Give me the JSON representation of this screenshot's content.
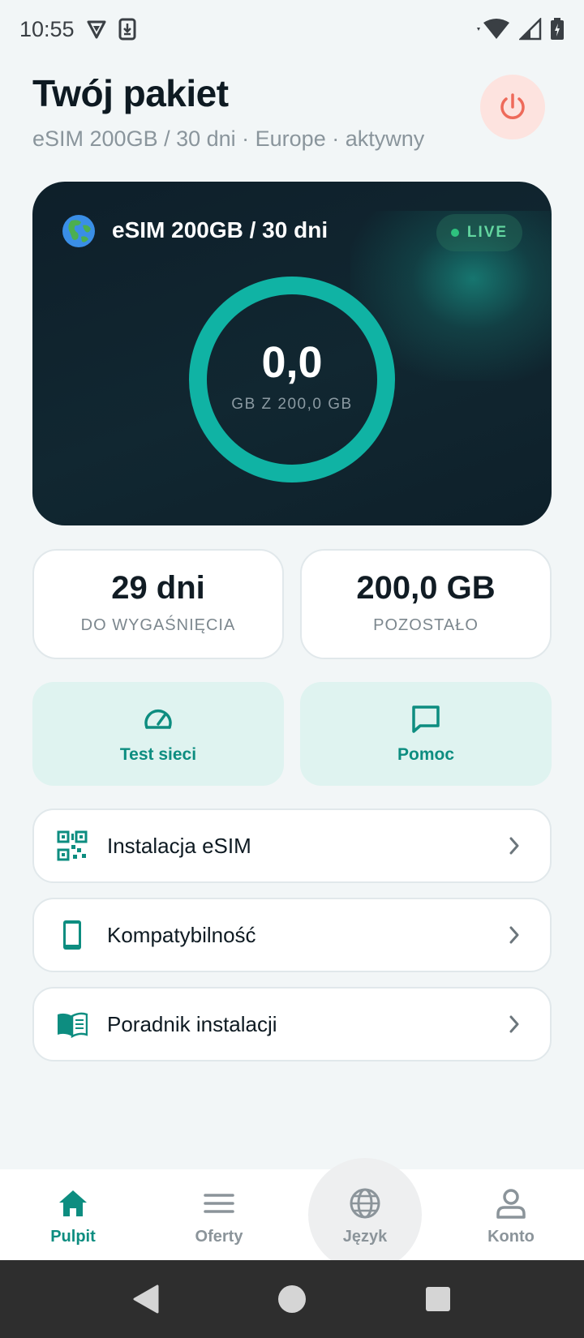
{
  "status_bar": {
    "time": "10:55",
    "icons": [
      "vpn-shield-icon",
      "download-icon",
      "wifi-icon",
      "signal-icon",
      "battery-icon"
    ]
  },
  "header": {
    "title": "Twój pakiet",
    "subtitle": "eSIM 200GB / 30 dni · Europe · aktywny",
    "power_icon": "power-icon"
  },
  "usage_card": {
    "plan_name": "eSIM 200GB / 30 dni",
    "badge": "LIVE",
    "used_value": "0,0",
    "caption": "GB Z 200,0 GB",
    "used_fraction": 0.0,
    "flag_icon": "globe-europe-emoji"
  },
  "stats": [
    {
      "value": "29 dni",
      "label": "DO WYGAŚNIĘCIA"
    },
    {
      "value": "200,0 GB",
      "label": "POZOSTAŁO"
    }
  ],
  "actions": [
    {
      "label": "Test sieci",
      "icon": "speedometer-icon"
    },
    {
      "label": "Pomoc",
      "icon": "chat-bubble-icon"
    }
  ],
  "menu": [
    {
      "label": "Instalacja eSIM",
      "icon": "qr-code-icon"
    },
    {
      "label": "Kompatybilność",
      "icon": "smartphone-icon"
    },
    {
      "label": "Poradnik instalacji",
      "icon": "book-icon"
    }
  ],
  "bottom_nav": [
    {
      "label": "Pulpit",
      "icon": "home-icon",
      "active": true
    },
    {
      "label": "Oferty",
      "icon": "menu-lines-icon",
      "active": false
    },
    {
      "label": "Język",
      "icon": "globe-icon",
      "active": false
    },
    {
      "label": "Konto",
      "icon": "user-icon",
      "active": false
    }
  ],
  "colors": {
    "accent": "#0d8d80",
    "ring": "#10b3a4",
    "card_bg": "#0f2029",
    "page_bg": "#f2f6f7",
    "power_bg": "#fde3df",
    "power_icon": "#ee6a5a",
    "tile_bg": "#dff3f0"
  }
}
